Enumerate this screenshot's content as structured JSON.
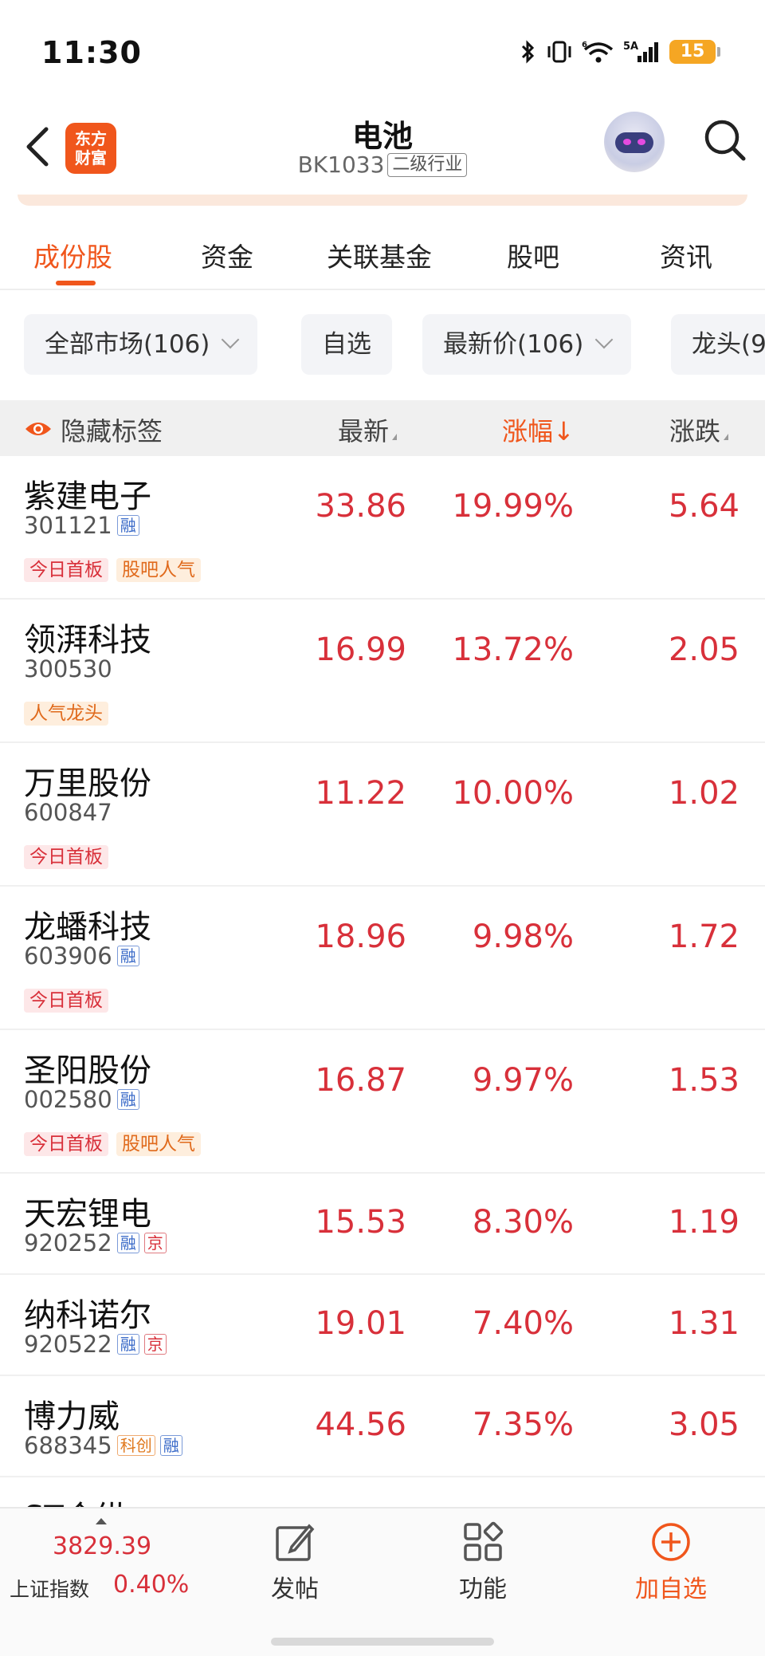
{
  "status_bar": {
    "time": "11:30",
    "network": "5A",
    "wifi_badge": "6",
    "battery": "15"
  },
  "header": {
    "title": "电池",
    "code": "BK1033",
    "tag": "二级行业",
    "logo_line1": "东方",
    "logo_line2": "财富"
  },
  "tabs": [
    "成份股",
    "资金",
    "关联基金",
    "股吧",
    "资讯"
  ],
  "filters": [
    "全部市场(106)",
    "自选",
    "最新价(106)",
    "龙头(9"
  ],
  "columns": {
    "hide_tags": "隐藏标签",
    "latest": "最新",
    "change_pct": "涨幅↓",
    "change": "涨跌"
  },
  "stocks": [
    {
      "name": "紫建电子",
      "code": "301121",
      "badges": [
        "融"
      ],
      "tags": [
        "今日首板",
        "股吧人气"
      ],
      "price": "33.86",
      "pct": "19.99%",
      "chg": "5.64"
    },
    {
      "name": "领湃科技",
      "code": "300530",
      "badges": [],
      "tags": [
        "人气龙头"
      ],
      "price": "16.99",
      "pct": "13.72%",
      "chg": "2.05"
    },
    {
      "name": "万里股份",
      "code": "600847",
      "badges": [],
      "tags": [
        "今日首板"
      ],
      "price": "11.22",
      "pct": "10.00%",
      "chg": "1.02"
    },
    {
      "name": "龙蟠科技",
      "code": "603906",
      "badges": [
        "融"
      ],
      "tags": [
        "今日首板"
      ],
      "price": "18.96",
      "pct": "9.98%",
      "chg": "1.72"
    },
    {
      "name": "圣阳股份",
      "code": "002580",
      "badges": [
        "融"
      ],
      "tags": [
        "今日首板",
        "股吧人气"
      ],
      "price": "16.87",
      "pct": "9.97%",
      "chg": "1.53"
    },
    {
      "name": "天宏锂电",
      "code": "920252",
      "badges": [
        "融",
        "京"
      ],
      "tags": [],
      "price": "15.53",
      "pct": "8.30%",
      "chg": "1.19"
    },
    {
      "name": "纳科诺尔",
      "code": "920522",
      "badges": [
        "融",
        "京"
      ],
      "tags": [],
      "price": "19.01",
      "pct": "7.40%",
      "chg": "1.31"
    },
    {
      "name": "博力威",
      "code": "688345",
      "badges": [
        "科创",
        "融"
      ],
      "tags": [],
      "price": "44.56",
      "pct": "7.35%",
      "chg": "3.05"
    },
    {
      "name": "ST合纵",
      "code": "",
      "badges": [],
      "tags": [],
      "price": "",
      "pct": "",
      "chg": ""
    }
  ],
  "bottom": {
    "index_value": "3829.39",
    "index_name": "上证指数",
    "index_change": "0.40%",
    "nav": [
      "发帖",
      "功能",
      "加自选"
    ]
  },
  "colors": {
    "accent": "#f0561c",
    "up": "#d8303a",
    "rong": "#3a6ac8"
  }
}
